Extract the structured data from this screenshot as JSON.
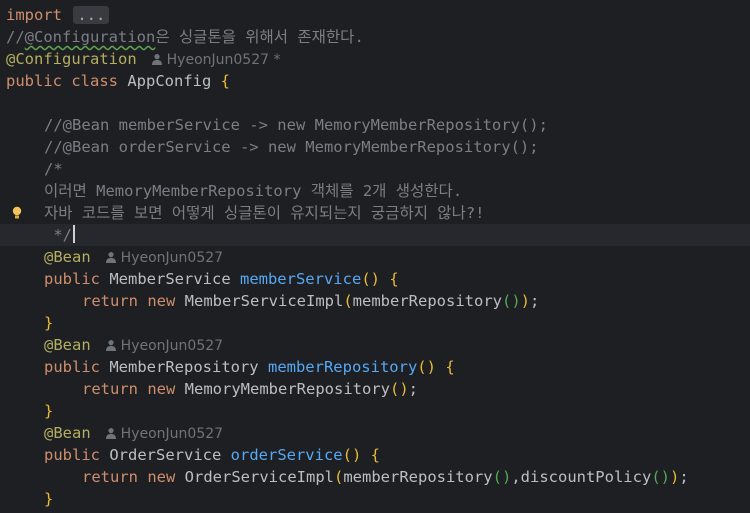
{
  "editor": {
    "lines": [
      {
        "tokens": [
          {
            "t": "import",
            "c": "kw"
          },
          {
            "t": " "
          },
          {
            "t": "...",
            "c": "fold"
          }
        ]
      },
      {
        "tokens": [
          {
            "t": "//",
            "c": "cmt"
          },
          {
            "t": "@Configuration",
            "c": "cmt squiggle"
          },
          {
            "t": "은 싱글톤을 위해서 존재한다.",
            "c": "cmt"
          }
        ]
      },
      {
        "tokens": [
          {
            "t": "@Configuration",
            "c": "ann"
          }
        ],
        "author": "HyeonJun0527 *"
      },
      {
        "tokens": [
          {
            "t": "public",
            "c": "kw"
          },
          {
            "t": " "
          },
          {
            "t": "class",
            "c": "kw"
          },
          {
            "t": " AppConfig "
          },
          {
            "t": "{",
            "c": "p1"
          }
        ]
      },
      {
        "tokens": []
      },
      {
        "tokens": [
          {
            "t": "//@Bean memberService -> new MemoryMemberRepository();",
            "c": "cmt"
          }
        ],
        "indent": 1
      },
      {
        "tokens": [
          {
            "t": "//@Bean orderService -> new MemoryMemberRepository();",
            "c": "cmt"
          }
        ],
        "indent": 1
      },
      {
        "tokens": [
          {
            "t": "/*",
            "c": "cmt"
          }
        ],
        "indent": 1
      },
      {
        "tokens": [
          {
            "t": "이러면 MemoryMemberRepository 객체를 2개 생성한다.",
            "c": "cmt"
          }
        ],
        "indent": 1
      },
      {
        "tokens": [
          {
            "t": "자바 코드를 보면 어떻게 싱글톤이 유지되는지 궁금하지 않나?!",
            "c": "cmt"
          }
        ],
        "indent": 1,
        "bulb": true
      },
      {
        "tokens": [
          {
            "t": " */",
            "c": "cmt"
          }
        ],
        "indent": 1,
        "caret": true,
        "current": true
      },
      {
        "tokens": [
          {
            "t": "@Bean",
            "c": "ann"
          }
        ],
        "indent": 1,
        "author": "HyeonJun0527"
      },
      {
        "tokens": [
          {
            "t": "public",
            "c": "kw"
          },
          {
            "t": " MemberService "
          },
          {
            "t": "memberService",
            "c": "fn"
          },
          {
            "t": "()",
            "c": "p1"
          },
          {
            "t": " "
          },
          {
            "t": "{",
            "c": "p1"
          }
        ],
        "indent": 1
      },
      {
        "tokens": [
          {
            "t": "return",
            "c": "kw"
          },
          {
            "t": " "
          },
          {
            "t": "new",
            "c": "kw"
          },
          {
            "t": " MemberServiceImpl"
          },
          {
            "t": "(",
            "c": "p1"
          },
          {
            "t": "memberRepository"
          },
          {
            "t": "()",
            "c": "p2"
          },
          {
            "t": ")",
            "c": "p1"
          },
          {
            "t": ";"
          }
        ],
        "indent": 2
      },
      {
        "tokens": [
          {
            "t": "}",
            "c": "p1"
          }
        ],
        "indent": 1
      },
      {
        "tokens": [
          {
            "t": "@Bean",
            "c": "ann"
          }
        ],
        "indent": 1,
        "author": "HyeonJun0527"
      },
      {
        "tokens": [
          {
            "t": "public",
            "c": "kw"
          },
          {
            "t": " MemberRepository "
          },
          {
            "t": "memberRepository",
            "c": "fn"
          },
          {
            "t": "()",
            "c": "p1"
          },
          {
            "t": " "
          },
          {
            "t": "{",
            "c": "p1"
          }
        ],
        "indent": 1
      },
      {
        "tokens": [
          {
            "t": "return",
            "c": "kw"
          },
          {
            "t": " "
          },
          {
            "t": "new",
            "c": "kw"
          },
          {
            "t": " MemoryMemberRepository"
          },
          {
            "t": "()",
            "c": "p1"
          },
          {
            "t": ";"
          }
        ],
        "indent": 2
      },
      {
        "tokens": [
          {
            "t": "}",
            "c": "p1"
          }
        ],
        "indent": 1
      },
      {
        "tokens": [
          {
            "t": "@Bean",
            "c": "ann"
          }
        ],
        "indent": 1,
        "author": "HyeonJun0527"
      },
      {
        "tokens": [
          {
            "t": "public",
            "c": "kw"
          },
          {
            "t": " OrderService "
          },
          {
            "t": "orderService",
            "c": "fn"
          },
          {
            "t": "()",
            "c": "p1"
          },
          {
            "t": " "
          },
          {
            "t": "{",
            "c": "p1"
          }
        ],
        "indent": 1
      },
      {
        "tokens": [
          {
            "t": "return",
            "c": "kw"
          },
          {
            "t": " "
          },
          {
            "t": "new",
            "c": "kw"
          },
          {
            "t": " OrderServiceImpl"
          },
          {
            "t": "(",
            "c": "p1"
          },
          {
            "t": "memberRepository"
          },
          {
            "t": "()",
            "c": "p2"
          },
          {
            "t": ","
          },
          {
            "t": "discountPolicy"
          },
          {
            "t": "()",
            "c": "p2"
          },
          {
            "t": ")",
            "c": "p1"
          },
          {
            "t": ";"
          }
        ],
        "indent": 2
      },
      {
        "tokens": [
          {
            "t": "}",
            "c": "p1"
          }
        ],
        "indent": 1
      }
    ]
  }
}
